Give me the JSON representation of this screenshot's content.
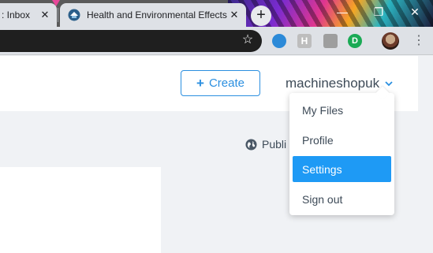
{
  "browser": {
    "tabs": [
      {
        "title": ": Inbox",
        "close": "✕"
      },
      {
        "title": "Health and Environmental Effects",
        "close": "✕"
      }
    ],
    "new_tab": "+",
    "window_controls": {
      "minimize": "—",
      "restore": "❐",
      "close": "✕"
    },
    "extensions": {
      "h_label": "H",
      "g_label": "D"
    },
    "menu_glyph": "⋮",
    "star_glyph": "☆"
  },
  "header": {
    "create_label": "Create",
    "create_plus": "+",
    "username": "machineshopuk"
  },
  "main": {
    "public_label": "Publi"
  },
  "dropdown": {
    "items": [
      {
        "label": "My Files",
        "active": false
      },
      {
        "label": "Profile",
        "active": false
      },
      {
        "label": "Settings",
        "active": true
      },
      {
        "label": "Sign out",
        "active": false
      }
    ]
  },
  "colors": {
    "accent": "#1e9af5",
    "create_border": "#2b8fe0",
    "text": "#3d4a57"
  }
}
